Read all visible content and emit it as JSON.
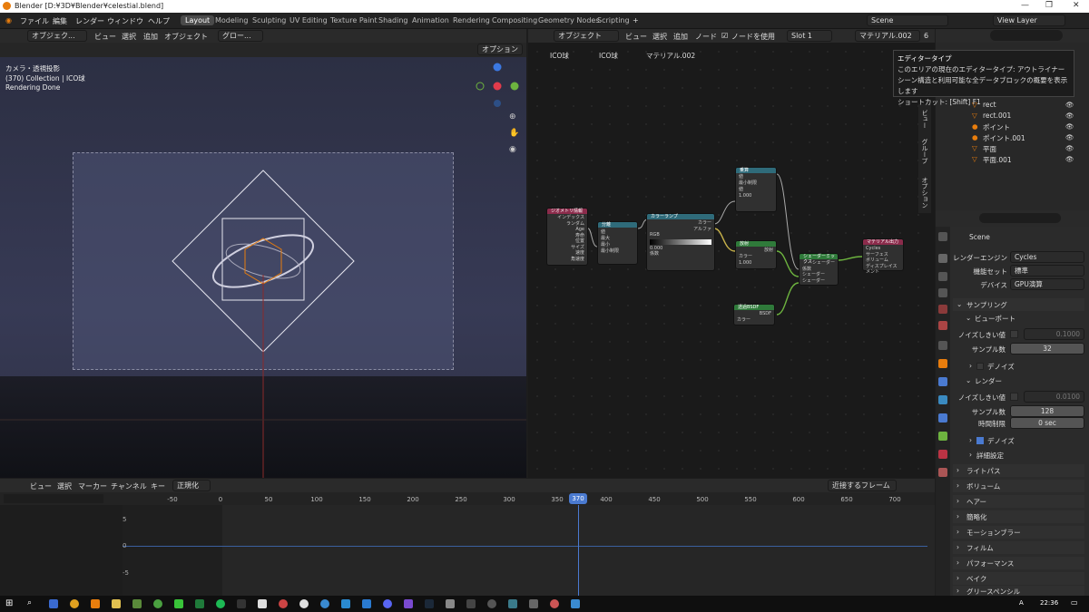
{
  "window": {
    "title": "Blender [D:¥3D¥Blender¥celestial.blend]",
    "controls": [
      "—",
      "❐",
      "✕"
    ]
  },
  "menu": [
    "ファイル",
    "編集",
    "レンダー",
    "ウィンドウ",
    "ヘルプ"
  ],
  "workspaces": [
    {
      "label": "Layout",
      "active": true
    },
    {
      "label": "Modeling"
    },
    {
      "label": "Sculpting"
    },
    {
      "label": "UV Editing"
    },
    {
      "label": "Texture Paint"
    },
    {
      "label": "Shading"
    },
    {
      "label": "Animation"
    },
    {
      "label": "Rendering"
    },
    {
      "label": "Compositing"
    },
    {
      "label": "Geometry Nodes"
    },
    {
      "label": "Scripting"
    }
  ],
  "scene": {
    "name": "Scene",
    "view_layer": "View Layer"
  },
  "viewport": {
    "mode": "オブジェク...",
    "menus": [
      "ビュー",
      "選択",
      "追加",
      "オブジェクト"
    ],
    "transform": "グロー...",
    "options": "オプション",
    "info": [
      "カメラ・透視投影",
      "(370) Collection | ICO球",
      "Rendering Done"
    ]
  },
  "node_editor": {
    "mode": "オブジェクト",
    "menus": [
      "ビュー",
      "選択",
      "追加",
      "ノード"
    ],
    "use_nodes": "ノードを使用",
    "slot": "Slot 1",
    "material": "マテリアル.002",
    "users": "6",
    "breadcrumb": [
      "ICO球",
      "ICO球",
      "マテリアル.002"
    ],
    "nodes": [
      {
        "title": "ジオメトリ情報",
        "color": "#8b2b4b",
        "rows": [
          "インデックス",
          "ランダム",
          "Age",
          "寿命",
          "位置",
          "サイズ",
          "速度",
          "角速度"
        ]
      },
      {
        "title": "分離",
        "color": "#2f6b7a",
        "rows": [
          "値",
          "最大",
          "最小",
          "最小制限"
        ]
      },
      {
        "title": "カラーランプ",
        "color": "#2f6b7a",
        "rows": [
          "カラー",
          "アルファ",
          "RGB",
          "リニア",
          "位置",
          "0.000",
          "係数"
        ]
      },
      {
        "title": "乗算",
        "color": "#2f6b7a",
        "rows": [
          "値",
          "値",
          "最小制限",
          "値",
          "1.000"
        ]
      },
      {
        "title": "放射",
        "color": "#2f7a3a",
        "rows": [
          "放射",
          "カラー",
          "強さ",
          "1.000"
        ]
      },
      {
        "title": "シェーダーミックス",
        "color": "#2f7a3a",
        "rows": [
          "シェーダー",
          "係数",
          "シェーダー",
          "シェーダー"
        ]
      },
      {
        "title": "マテリアル出力",
        "color": "#8b2b4b",
        "rows": [
          "Cycles",
          "サーフェス",
          "ボリューム",
          "ディスプレイスメント"
        ]
      },
      {
        "title": "透過BSDF",
        "color": "#2f7a3a",
        "rows": [
          "BSDF",
          "カラー"
        ]
      }
    ]
  },
  "tooltip": {
    "title": "エディタータイプ",
    "lines": [
      "このエリアの現在のエディタータイプ: アウトライナー",
      "シーン構造と利用可能な全データブロックの概要を表示します",
      "ショートカット: [Shift] F1"
    ]
  },
  "side_tabs": [
    "ビュー",
    "グループ",
    "オプション"
  ],
  "outliner": {
    "items": [
      {
        "label": "rect",
        "icon": "mesh-icon"
      },
      {
        "label": "rect.001",
        "icon": "mesh-icon"
      },
      {
        "label": "ポイント",
        "icon": "light-icon"
      },
      {
        "label": "ポイント.001",
        "icon": "light-icon"
      },
      {
        "label": "平面",
        "icon": "mesh-icon"
      },
      {
        "label": "平面.001",
        "icon": "mesh-icon"
      }
    ]
  },
  "properties": {
    "scene_label": "Scene",
    "render_engine": {
      "label": "レンダーエンジン",
      "value": "Cycles"
    },
    "feature_set": {
      "label": "機能セット",
      "value": "標準"
    },
    "device": {
      "label": "デバイス",
      "value": "GPU演算"
    },
    "sampling": "サンプリング",
    "viewport_sub": "ビューポート",
    "vp_noise": {
      "label": "ノイズしきい値",
      "value": "0.1000"
    },
    "vp_samples": {
      "label": "サンプル数",
      "value": "32"
    },
    "vp_denoise": "デノイズ",
    "render_sub": "レンダー",
    "r_noise": {
      "label": "ノイズしきい値",
      "value": "0.0100"
    },
    "r_samples": {
      "label": "サンプル数",
      "value": "128"
    },
    "r_time": {
      "label": "時間制限",
      "value": "0 sec"
    },
    "r_denoise": "デノイズ",
    "advanced": "詳細設定",
    "sections": [
      "ライトパス",
      "ボリューム",
      "ヘアー",
      "簡略化",
      "モーションブラー",
      "フィルム",
      "パフォーマンス",
      "ベイク",
      "グリースペンシル"
    ]
  },
  "timeline": {
    "menus": [
      "ビュー",
      "選択",
      "マーカー",
      "チャンネル",
      "キー"
    ],
    "normalize": "正規化",
    "keyframe_mode": "近接するフレーム",
    "ticks": [
      "-50",
      "0",
      "50",
      "100",
      "150",
      "200",
      "250",
      "300",
      "350",
      "400",
      "450",
      "500",
      "550",
      "600",
      "650",
      "700"
    ],
    "current_frame": "370",
    "y_labels": [
      "5",
      "0",
      "-5"
    ]
  },
  "taskbar": {
    "time": "22:36",
    "ime": "A"
  }
}
